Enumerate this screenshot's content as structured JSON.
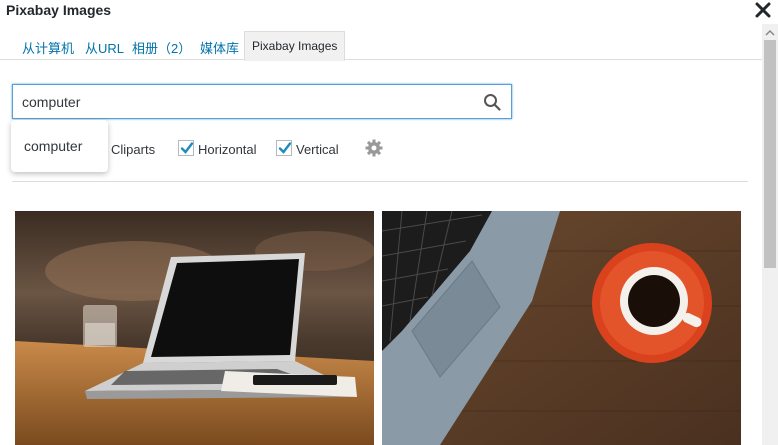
{
  "dialog": {
    "title": "Pixabay Images"
  },
  "tabs": [
    {
      "label": "从计算机"
    },
    {
      "label": "从URL"
    },
    {
      "label": "相册（2）"
    },
    {
      "label": "媒体库"
    },
    {
      "label": "Pixabay Images",
      "active": true
    }
  ],
  "search": {
    "value": "computer",
    "placeholder": ""
  },
  "suggestions": [
    {
      "label": "computer"
    }
  ],
  "filters": {
    "cliparts_label": "Cliparts",
    "horizontal_label": "Horizontal",
    "horizontal_checked": true,
    "vertical_label": "Vertical",
    "vertical_checked": true
  },
  "results": [
    {
      "icon": "laptop-on-wooden-table-photo"
    },
    {
      "icon": "laptop-with-coffee-cup-photo"
    }
  ],
  "colors": {
    "link": "#0073aa",
    "focus_border": "#5b9dd9",
    "checkmark": "#1e8cbe"
  }
}
